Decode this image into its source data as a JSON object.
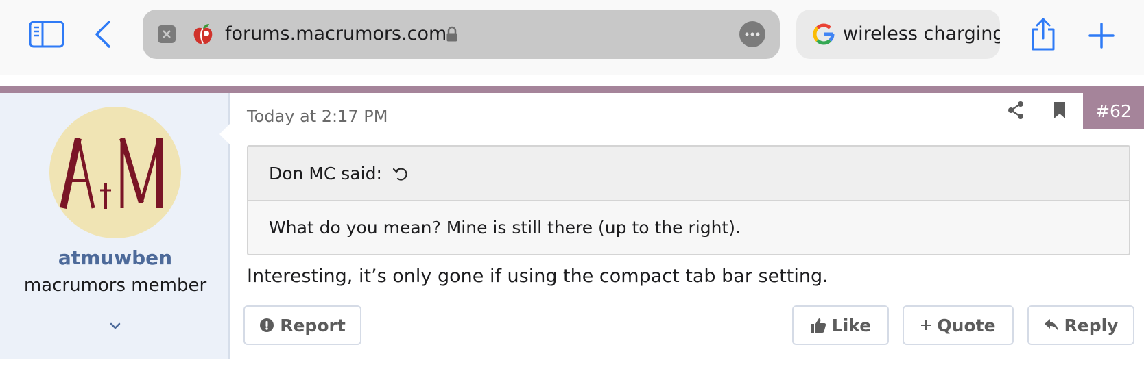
{
  "browser": {
    "url": "forums.macrumors.com",
    "search_tab": "wireless charging",
    "icons": {
      "sidebar": "sidebar-icon",
      "back": "chevron-left-icon",
      "close": "close-icon",
      "favicon": "macrumors-apple-icon",
      "lock": "lock-icon",
      "more": "ellipsis-icon",
      "google": "google-icon",
      "share": "share-icon",
      "new_tab": "plus-icon"
    },
    "accent_color": "#2f7bf6"
  },
  "post": {
    "user": {
      "avatar_text": "AtM",
      "username": "atmuwben",
      "title": "macrumors member"
    },
    "time": "Today at 2:17 PM",
    "number": "#62",
    "quote": {
      "author": "Don MC said:",
      "text": "What do you mean? Mine is still there (up to the right)."
    },
    "message": "Interesting, it’s only gone if using the compact tab bar setting.",
    "actions": {
      "report": "Report",
      "like": "Like",
      "quote": "Quote",
      "reply": "Reply"
    },
    "colors": {
      "accent": "#a5849a",
      "username": "#4d6a9a",
      "user_panel": "#ecf1f9"
    }
  }
}
